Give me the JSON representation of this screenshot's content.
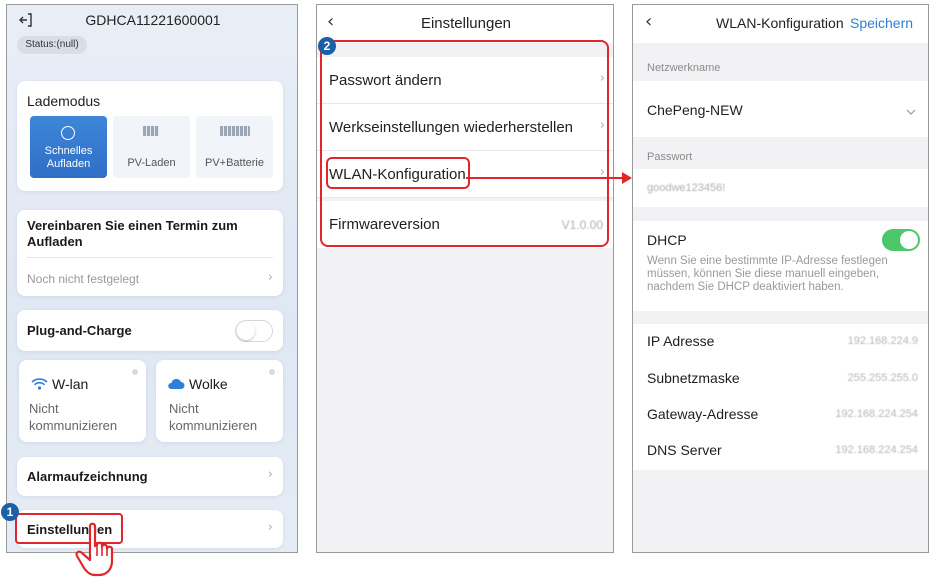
{
  "panel1": {
    "header_title": "GDHCA11221600001",
    "status": "Status:(null)",
    "charge_mode": {
      "title": "Lademodus",
      "modes": [
        "Schnelles\nAufladen",
        "PV-Laden",
        "PV+Batterie"
      ],
      "selected": "Schnelles Aufladen"
    },
    "appointment": {
      "title": "Vereinbaren Sie einen Termin zum Aufladen",
      "value": "Noch nicht festgelegt"
    },
    "plug_and_charge": {
      "label": "Plug-and-Charge",
      "enabled": false
    },
    "wlan": {
      "title": "W-lan",
      "status_line1": "Nicht",
      "status_line2": "kommunizieren"
    },
    "cloud": {
      "title": "Wolke",
      "status_line1": "Nicht",
      "status_line2": "kommunizieren"
    },
    "alarm_label": "Alarmaufzeichnung",
    "settings_label": "Einstellungen",
    "badge": "1"
  },
  "panel2": {
    "title": "Einstellungen",
    "badge": "2",
    "items": [
      {
        "label": "Passwort ändern",
        "value": ""
      },
      {
        "label": "Werkseinstellungen wiederherstellen",
        "value": ""
      },
      {
        "label": "WLAN-Konfiguration",
        "value": ""
      },
      {
        "label": "Firmwareversion",
        "value": "V1.0.00"
      }
    ]
  },
  "panel3": {
    "title": "WLAN-Konfiguration",
    "save_label": "Speichern",
    "network_name_label": "Netzwerkname",
    "network_name_value": "ChePeng-NEW",
    "password_label": "Passwort",
    "password_value": "goodwe123456!",
    "dhcp_label": "DHCP",
    "dhcp_enabled": true,
    "dhcp_hint": "Wenn Sie eine bestimmte IP-Adresse festlegen müssen, können Sie diese manuell eingeben, nachdem Sie DHCP deaktiviert haben.",
    "ip_rows": [
      {
        "label": "IP Adresse",
        "value": "192.168.224.9"
      },
      {
        "label": "Subnetzmaske",
        "value": "255.255.255.0"
      },
      {
        "label": "Gateway-Adresse",
        "value": "192.168.224.254"
      },
      {
        "label": "DNS Server",
        "value": "192.168.224.254"
      }
    ]
  },
  "colors": {
    "accent": "#2f6fc6",
    "highlight": "#e0262b",
    "toggle_on": "#4cc86b",
    "badge": "#1a5fa8"
  }
}
